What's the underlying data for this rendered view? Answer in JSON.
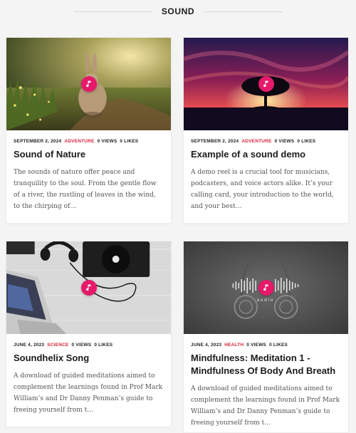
{
  "section": {
    "title": "SOUND"
  },
  "cards": [
    {
      "date": "SEPTEMBER 2, 2024",
      "category": "ADVENTURE",
      "views": "0 VIEWS",
      "likes": "0 LIKES",
      "title": "Sound of Nature",
      "excerpt": "The sounds of nature offer peace and tranquility to the soul. From the gentle flow of a river, the rustling of leaves in the wind, to the chirping of…",
      "image": "rabbit-on-forest-path"
    },
    {
      "date": "SEPTEMBER 2, 2024",
      "category": "ADVENTURE",
      "views": "0 VIEWS",
      "likes": "0 LIKES",
      "title": "Example of a sound demo",
      "excerpt": "A demo reel is a crucial tool for musicians, podcasters, and voice actors alike. It’s your calling card, your introduction to the world, and your best…",
      "image": "tree-silhouette-sunset"
    },
    {
      "date": "JUNE 4, 2023",
      "category": "SCIENCE",
      "views": "0 VIEWS",
      "likes": "0 LIKES",
      "title": "Soundhelix Song",
      "excerpt": "A download of guided meditations aimed to complement the learnings found in Prof Mark William’s and Dr Danny Penman’s guide to freeing yourself from t…",
      "image": "turntable-headphones-laptop"
    },
    {
      "date": "JUNE 4, 2023",
      "category": "HEALTH",
      "views": "0 VIEWS",
      "likes": "0 LIKES",
      "title": "Mindfulness: Meditation 1 - Mindfulness Of Body And Breath",
      "excerpt": "A download of guided meditations aimed to complement the learnings found in Prof Mark William’s and Dr Danny Penman’s guide to freeing yourself from t…",
      "image": "headphones-audio-waveform",
      "image_text": "audio"
    }
  ],
  "colors": {
    "accent": "#e6196b",
    "category": "#d8263a"
  },
  "icons": {
    "badge": "music-note-icon"
  }
}
